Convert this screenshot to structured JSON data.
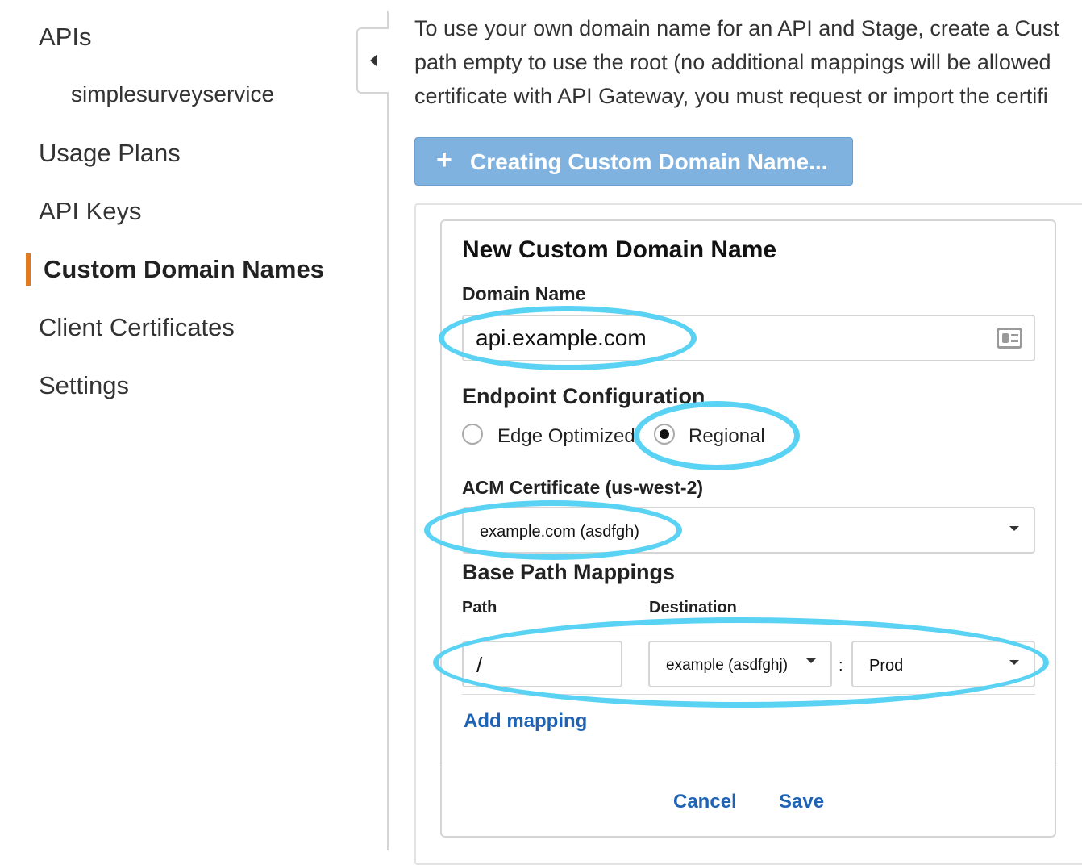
{
  "sidebar": {
    "items": [
      {
        "label": "APIs"
      },
      {
        "label": "simplesurveyservice"
      },
      {
        "label": "Usage Plans"
      },
      {
        "label": "API Keys"
      },
      {
        "label": "Custom Domain Names"
      },
      {
        "label": "Client Certificates"
      },
      {
        "label": "Settings"
      }
    ]
  },
  "intro": {
    "lines": [
      "To use your own domain name for an API and Stage, create a Cust",
      "path empty to use the root (no additional mappings will be allowed",
      "certificate with API Gateway, you must request or import the certifi"
    ]
  },
  "create_button": {
    "label": "Creating Custom Domain Name..."
  },
  "form": {
    "title": "New Custom Domain Name",
    "domain_label": "Domain Name",
    "domain_value": "api.example.com",
    "endpoint_label": "Endpoint Configuration",
    "endpoint_options": [
      {
        "label": "Edge Optimized",
        "checked": false
      },
      {
        "label": "Regional",
        "checked": true
      }
    ],
    "acm_label": "ACM Certificate (us-west-2)",
    "acm_value": "example.com (asdfgh)",
    "mappings_title": "Base Path Mappings",
    "path_header": "Path",
    "destination_header": "Destination",
    "mapping": {
      "path": "/",
      "api": "example (asdfghj)",
      "separator": ":",
      "stage": "Prod"
    },
    "add_mapping": "Add mapping",
    "cancel": "Cancel",
    "save": "Save"
  },
  "colors": {
    "accent": "#e07b22",
    "link": "#1f63b5",
    "highlight": "#5ad2f4",
    "button_disabled": "#7fb2df"
  }
}
